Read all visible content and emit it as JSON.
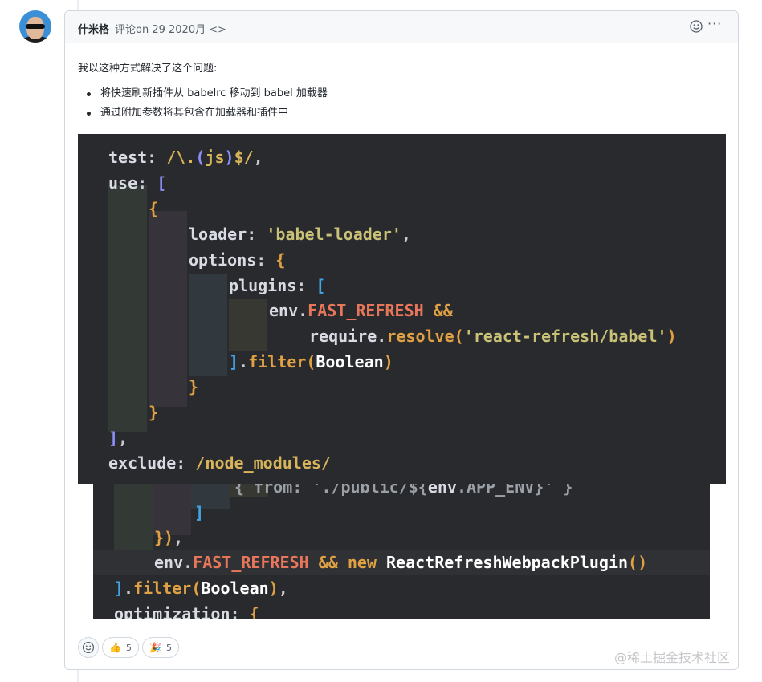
{
  "comment": {
    "author": "什米格",
    "meta": "评论on 29 2020月",
    "code_symbol": "<>",
    "emoji_icon": "smiley-icon",
    "more_icon": "kebab-horizontal-icon",
    "more_glyph": "···",
    "intro": "我以这种方式解决了这个问题:",
    "bullets": [
      "将快速刷新插件从 babelrc 移动到 babel 加载器",
      "通过附加参数将其包含在加载器和插件中"
    ]
  },
  "code_top": {
    "lines": [
      [
        {
          "t": "test",
          "c": "tk-key"
        },
        {
          "t": ": ",
          "c": "tk-punct"
        },
        {
          "t": "/\\.",
          "c": "tk-re"
        },
        {
          "t": "(",
          "c": "tk-br1"
        },
        {
          "t": "js",
          "c": "tk-re"
        },
        {
          "t": ")",
          "c": "tk-br1"
        },
        {
          "t": "$/",
          "c": "tk-re"
        },
        {
          "t": ",",
          "c": "tk-punct"
        }
      ],
      [
        {
          "t": "use",
          "c": "tk-key"
        },
        {
          "t": ": ",
          "c": "tk-punct"
        },
        {
          "t": "[",
          "c": "tk-br1"
        }
      ],
      [
        {
          "t": "{",
          "c": "tk-br2"
        }
      ],
      [
        {
          "t": "loader",
          "c": "tk-key"
        },
        {
          "t": ": ",
          "c": "tk-punct"
        },
        {
          "t": "'babel-loader'",
          "c": "tk-str"
        },
        {
          "t": ",",
          "c": "tk-punct"
        }
      ],
      [
        {
          "t": "options",
          "c": "tk-key"
        },
        {
          "t": ": ",
          "c": "tk-punct"
        },
        {
          "t": "{",
          "c": "tk-br2"
        }
      ],
      [
        {
          "t": "plugins",
          "c": "tk-key"
        },
        {
          "t": ": ",
          "c": "tk-punct"
        },
        {
          "t": "[",
          "c": "tk-br3"
        }
      ],
      [
        {
          "t": "env",
          "c": "tk-obj"
        },
        {
          "t": ".",
          "c": "tk-punct"
        },
        {
          "t": "FAST_REFRESH",
          "c": "tk-const"
        },
        {
          "t": " &&",
          "c": "tk-fn"
        }
      ],
      [
        {
          "t": "require",
          "c": "tk-obj"
        },
        {
          "t": ".",
          "c": "tk-punct"
        },
        {
          "t": "resolve",
          "c": "tk-fn"
        },
        {
          "t": "(",
          "c": "tk-br2"
        },
        {
          "t": "'react-refresh/babel'",
          "c": "tk-str"
        },
        {
          "t": ")",
          "c": "tk-br2"
        }
      ],
      [
        {
          "t": "]",
          "c": "tk-br3"
        },
        {
          "t": ".",
          "c": "tk-punct"
        },
        {
          "t": "filter",
          "c": "tk-fn"
        },
        {
          "t": "(",
          "c": "tk-br2"
        },
        {
          "t": "Boolean",
          "c": "tk-type"
        },
        {
          "t": ")",
          "c": "tk-br2"
        }
      ],
      [
        {
          "t": "}",
          "c": "tk-br2"
        }
      ],
      [
        {
          "t": "}",
          "c": "tk-br2"
        }
      ],
      [
        {
          "t": "]",
          "c": "tk-br1"
        },
        {
          "t": ",",
          "c": "tk-punct"
        }
      ],
      [
        {
          "t": "exclude",
          "c": "tk-key"
        },
        {
          "t": ": ",
          "c": "tk-punct"
        },
        {
          "t": "/node_modules/",
          "c": "tk-re"
        }
      ]
    ]
  },
  "code_bottom": {
    "lines": [
      [
        {
          "t": "{ from: './public/${",
          "c": "tk-dim"
        },
        {
          "t": "env",
          "c": "tk-obj"
        },
        {
          "t": ".APP_ENV}' }",
          "c": "tk-dim"
        }
      ],
      [
        {
          "t": "]",
          "c": "tk-br3"
        }
      ],
      [
        {
          "t": "}",
          "c": "tk-br2"
        },
        {
          "t": ")",
          "c": "tk-fn"
        },
        {
          "t": ",",
          "c": "tk-punct"
        }
      ],
      [
        {
          "t": "env",
          "c": "tk-obj"
        },
        {
          "t": ".",
          "c": "tk-punct"
        },
        {
          "t": "FAST_REFRESH",
          "c": "tk-const"
        },
        {
          "t": " && ",
          "c": "tk-fn"
        },
        {
          "t": "new ",
          "c": "tk-kw"
        },
        {
          "t": "ReactRefreshWebpackPlugin",
          "c": "tk-type"
        },
        {
          "t": "()",
          "c": "tk-br2"
        }
      ],
      [
        {
          "t": "]",
          "c": "tk-br3"
        },
        {
          "t": ".",
          "c": "tk-punct"
        },
        {
          "t": "filter",
          "c": "tk-fn"
        },
        {
          "t": "(",
          "c": "tk-br2"
        },
        {
          "t": "Boolean",
          "c": "tk-type"
        },
        {
          "t": ")",
          "c": "tk-br2"
        },
        {
          "t": ",",
          "c": "tk-punct"
        }
      ],
      [
        {
          "t": "optimization",
          "c": "tk-key"
        },
        {
          "t": ": ",
          "c": "tk-punct"
        },
        {
          "t": "{",
          "c": "tk-br2"
        }
      ]
    ]
  },
  "reactions": {
    "add_icon": "smiley-icon",
    "items": [
      {
        "icon": "thumbs-up-icon",
        "glyph": "👍",
        "count": "5"
      },
      {
        "icon": "party-popper-icon",
        "glyph": "🎉",
        "count": "5"
      }
    ]
  },
  "watermark": "@稀土掘金技术社区"
}
